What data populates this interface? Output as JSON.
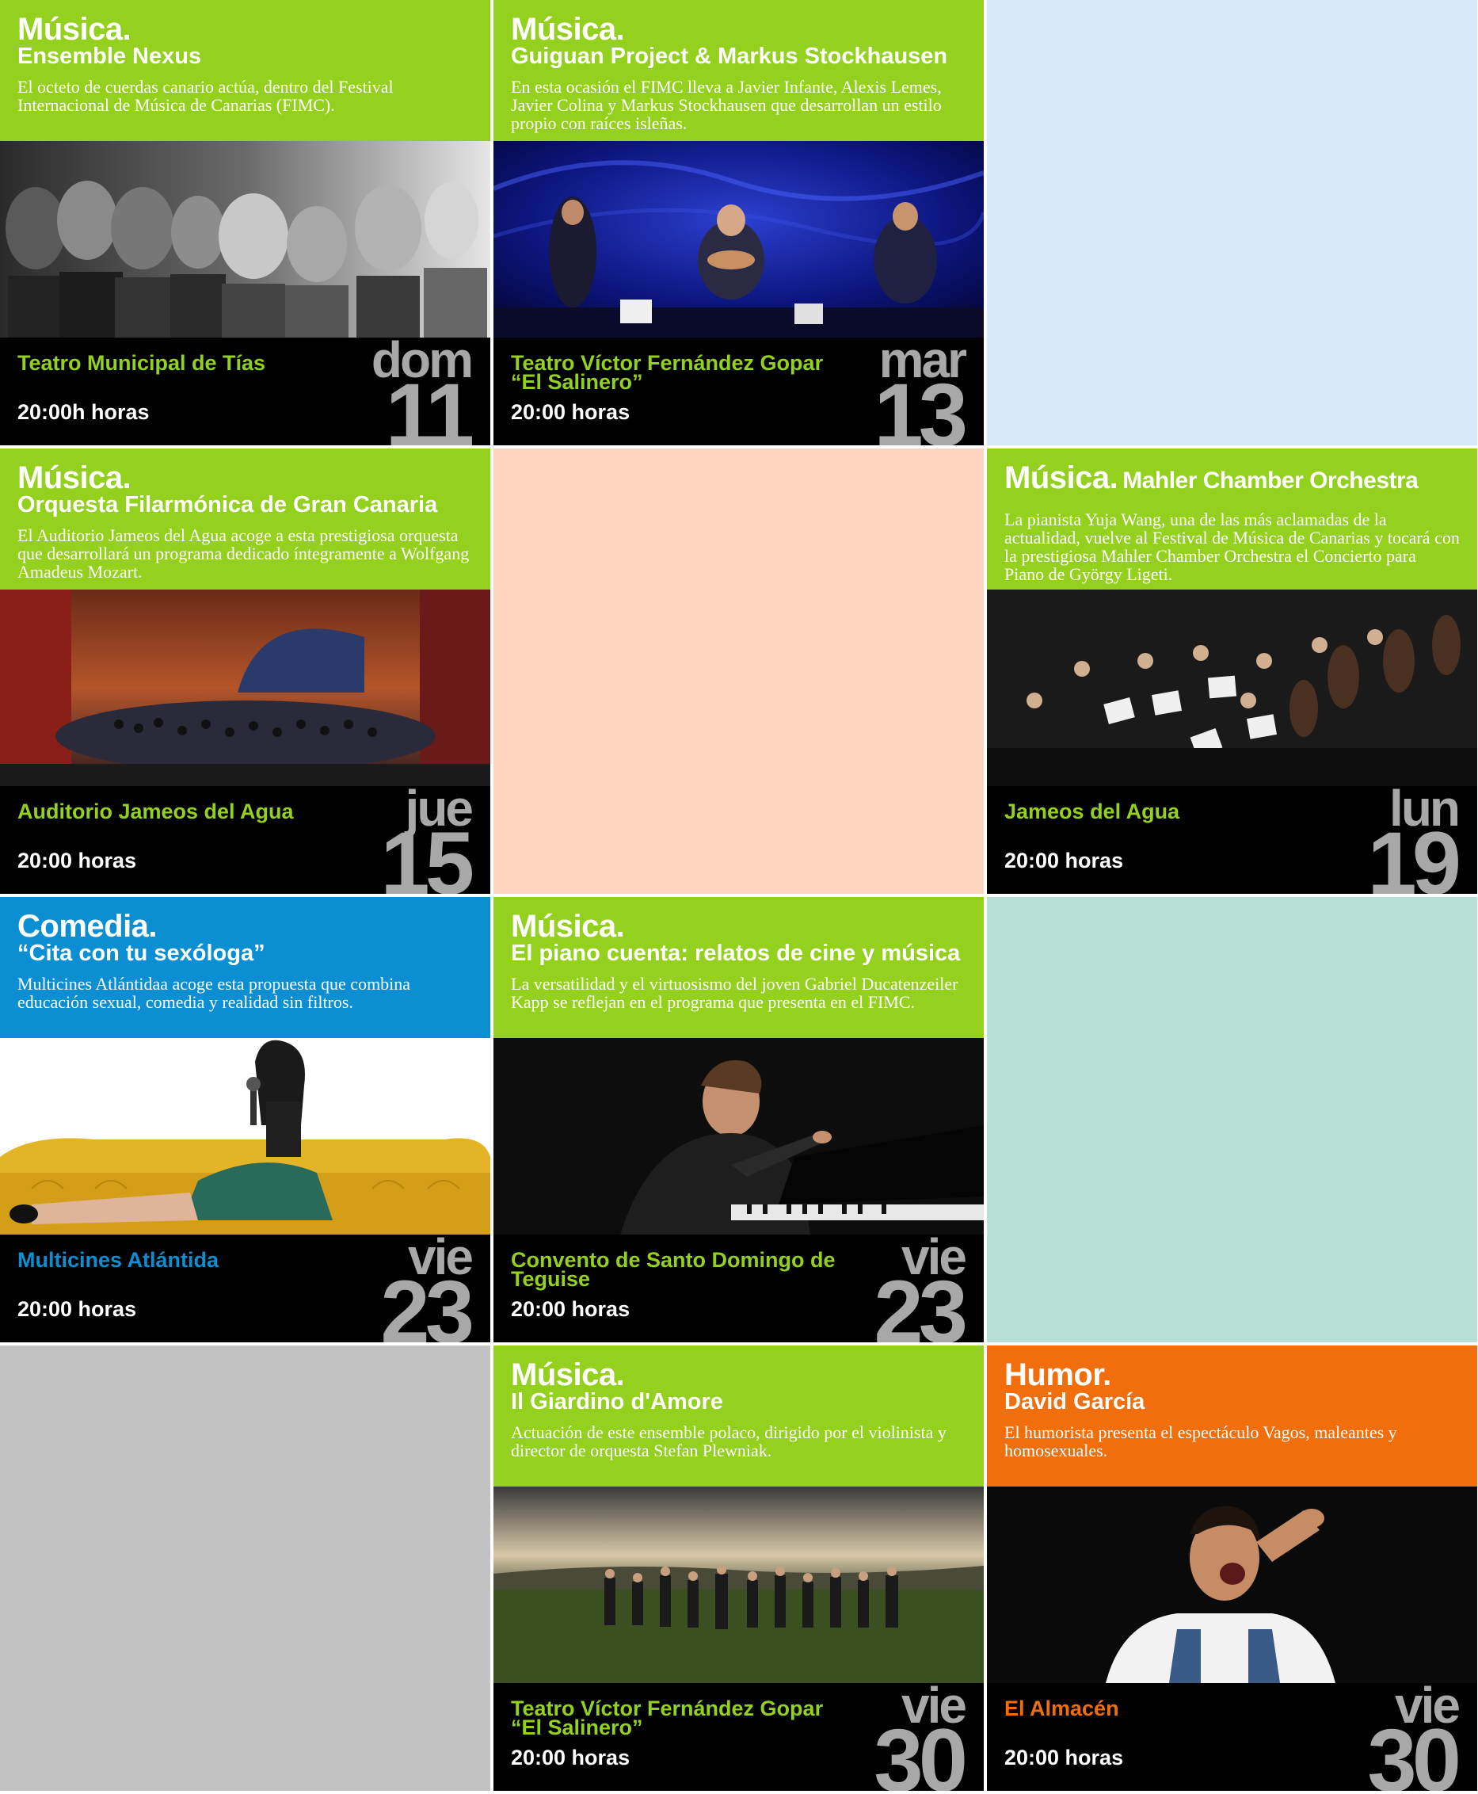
{
  "events": [
    {
      "category": "Música.",
      "title": "Ensemble Nexus",
      "description": "El octeto de cuerdas canario actúa, dentro del Festival Internacional de Música de Canarias (FIMC).",
      "venue": "Teatro Municipal de Tías",
      "time": "20:00h horas",
      "weekday": "dom",
      "day": "11",
      "color": "#94d01e"
    },
    {
      "category": "Música.",
      "title": "Guiguan Project & Markus Stockhausen",
      "description": "En esta ocasión el FIMC lleva a Javier Infante, Alexis Lemes, Javier Colina y Markus Stockhausen que desarrollan un estilo propio con raíces isleñas.",
      "venue": "Teatro Víctor Fernández Gopar “El Salinero”",
      "time": "20:00 horas",
      "weekday": "mar",
      "day": "13",
      "color": "#94d01e"
    },
    {
      "category": "Música.",
      "title": "Orquesta Filarmónica de Gran Canaria",
      "description": "El Auditorio Jameos del Agua acoge a esta prestigiosa orquesta que desarrollará un programa dedicado íntegramente a Wolfgang Amadeus Mozart.",
      "venue": "Auditorio Jameos del Agua",
      "time": "20:00 horas",
      "weekday": "jue",
      "day": "15",
      "color": "#94d01e"
    },
    {
      "category": "Música.",
      "title": "Mahler Chamber Orchestra",
      "description": "La pianista Yuja Wang, una de las más aclamadas de la actualidad, vuelve al Festival de Música de Canarias y tocará con la prestigiosa Mahler Chamber Orchestra el Concierto para Piano de György Ligeti.",
      "venue": "Jameos del Agua",
      "time": "20:00 horas",
      "weekday": "lun",
      "day": "19",
      "color": "#94d01e"
    },
    {
      "category": "Comedia.",
      "title": "“Cita con tu sexóloga”",
      "description": "Multicines Atlántidaa acoge esta propuesta que combina educación sexual, comedia y realidad sin filtros.",
      "venue": "Multicines Atlántida",
      "time": "20:00 horas",
      "weekday": "vie",
      "day": "23",
      "color": "#0b8fd2"
    },
    {
      "category": "Música.",
      "title": "El piano cuenta: relatos de cine y música",
      "description": "La versatilidad y el virtuosismo del joven Gabriel Ducatenzeiler Kapp se reflejan en el programa que presenta en el FIMC.",
      "venue": "Convento de Santo Domingo de Teguise",
      "time": "20:00 horas",
      "weekday": "vie",
      "day": "23",
      "color": "#94d01e"
    },
    {
      "category": "Música.",
      "title": "Il Giardino d'Amore",
      "description": "Actuación de este ensemble polaco, dirigido por el violinista y director de orquesta Stefan Plewniak.",
      "venue": "Teatro Víctor Fernández Gopar “El Salinero”",
      "time": "20:00 horas",
      "weekday": "vie",
      "day": "30",
      "color": "#94d01e"
    },
    {
      "category": "Humor.",
      "title": "David García",
      "description": "El humorista presenta el espectáculo Vagos, maleantes y homosexuales.",
      "venue": "El Almacén",
      "time": "20:00 horas",
      "weekday": "vie",
      "day": "30",
      "color": "#f06e0c"
    }
  ]
}
